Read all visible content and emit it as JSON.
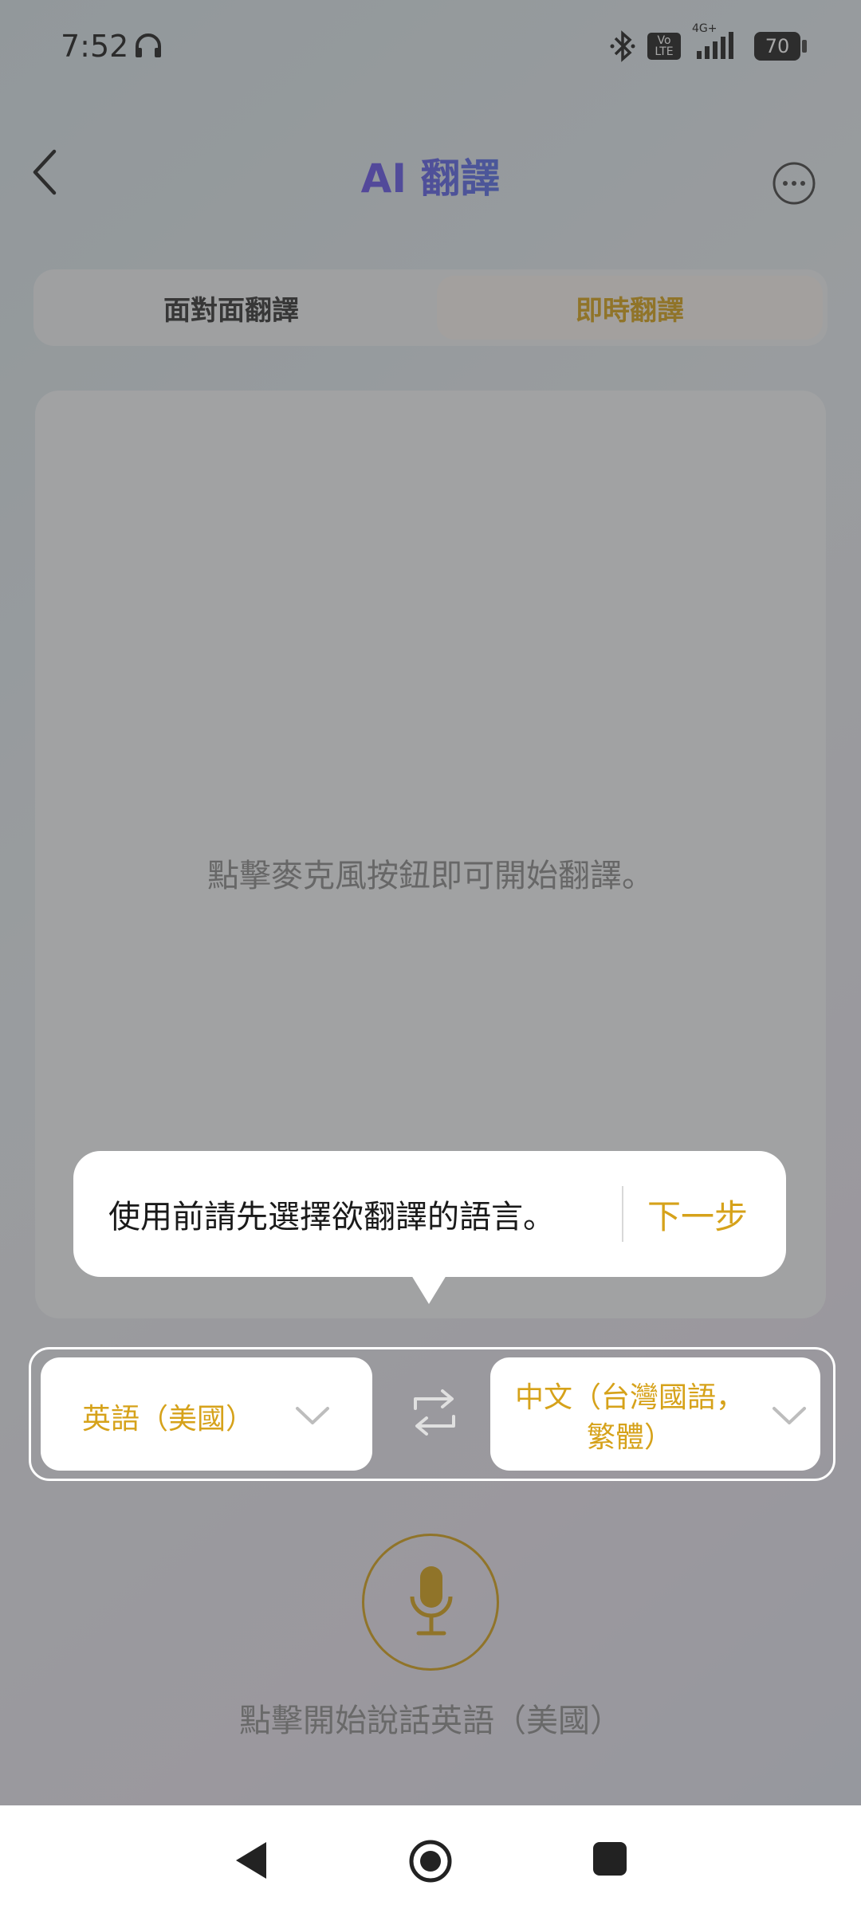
{
  "status_bar": {
    "time": "7:52",
    "network": "4G+",
    "volte_top": "Vo",
    "volte_bottom": "LTE",
    "battery": "70"
  },
  "header": {
    "title": "AI 翻譯"
  },
  "tabs": [
    {
      "label": "面對面翻譯",
      "selected": false
    },
    {
      "label": "即時翻譯",
      "selected": true
    }
  ],
  "panel": {
    "hint": "點擊麥克風按鈕即可開始翻譯。"
  },
  "tooltip": {
    "message": "使用前請先選擇欲翻譯的語言。",
    "next_label": "下一步"
  },
  "languages": {
    "source": "英語（美國）",
    "target_line1": "中文（台灣國語，",
    "target_line2": "繁體）"
  },
  "mic": {
    "caption": "點擊開始說話英語（美國）"
  },
  "colors": {
    "accent": "#d6a21a",
    "title_gradient_start": "#4a2ed8",
    "title_gradient_end": "#3aa0e0"
  }
}
